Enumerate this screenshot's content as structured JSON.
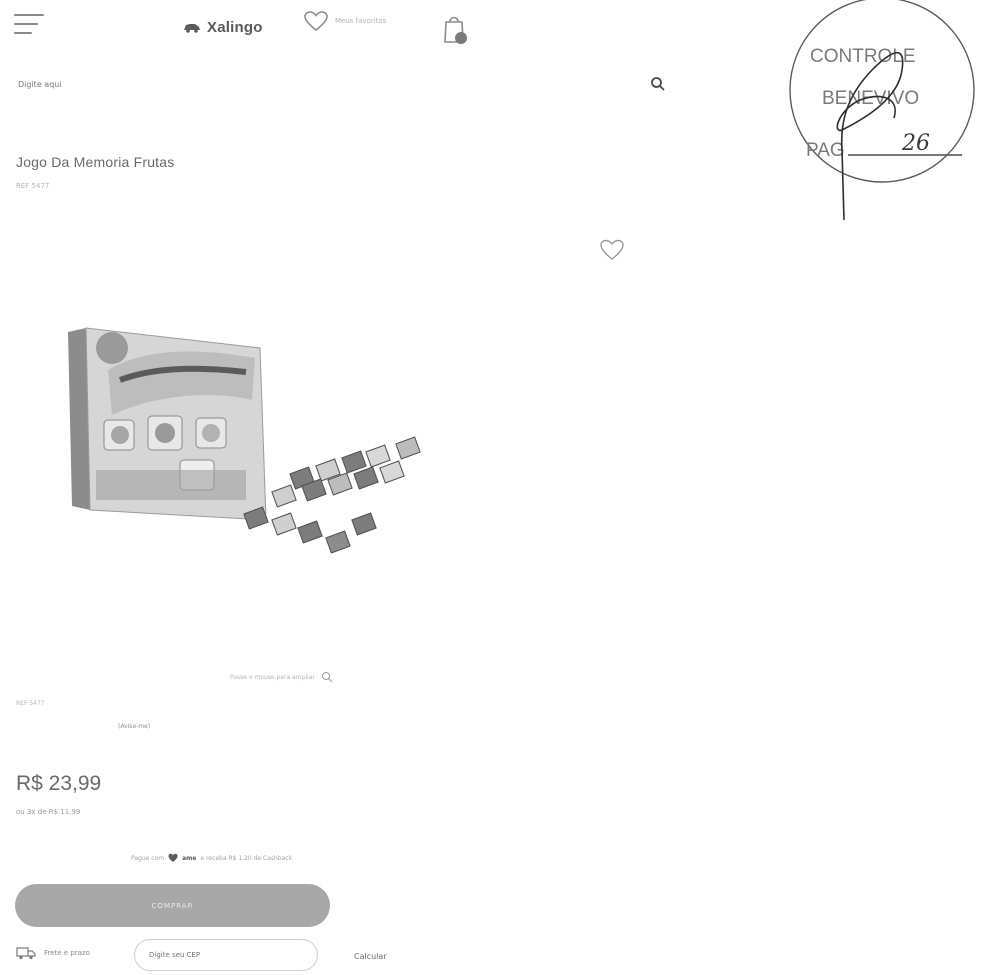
{
  "header": {
    "logo_text": "Xalingo",
    "wishlist_label": "Meus favoritos",
    "search_placeholder": "Digite aqui"
  },
  "stamp": {
    "line1": "CONTROLE",
    "line2": "BENEVIVO",
    "line3": "PAG",
    "number": "26"
  },
  "product": {
    "title": "Jogo Da Memoria Frutas",
    "ref": "REF 5477",
    "hover_hint": "Passe o mouse para ampliar",
    "ref_secondary": "REF 5477",
    "notify": "(Avise-me)",
    "price": "R$ 23,99",
    "installment": "ou 3x de R$ 11,99",
    "ame_text_before": "Pague com",
    "ame_brand": "ame",
    "ame_text_after": "e receba R$ 1,20 de Cashback",
    "buy_label": "COMPRAR",
    "shipping_label": "Frete e prazo",
    "cep_placeholder": "Digite seu CEP",
    "calc_label": "Calcular"
  },
  "colors": {
    "button": "#a8a8a8",
    "text": "#6a6a6a"
  }
}
